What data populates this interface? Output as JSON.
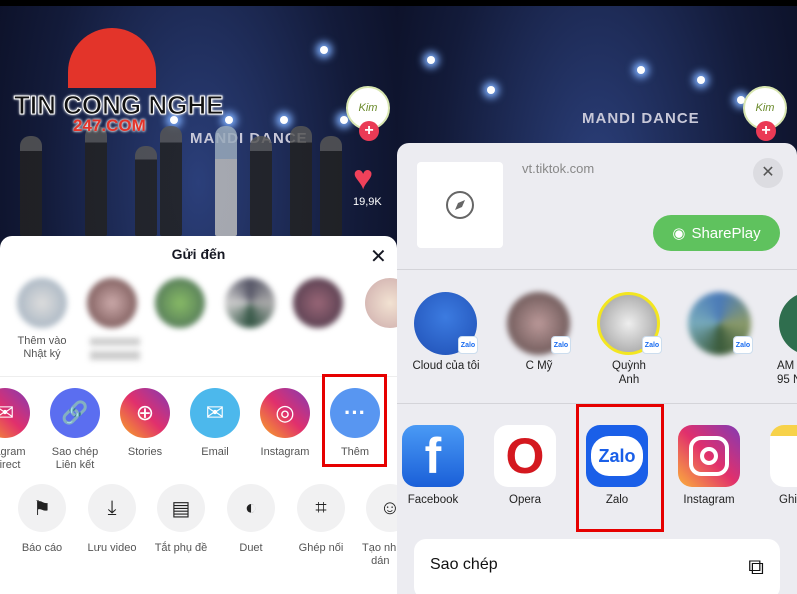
{
  "left": {
    "watermark": {
      "line1": "TIN CONG NGHE",
      "line2": "247.COM"
    },
    "video_sign": "MANDI DANCE",
    "creator_avatar_text": "Kim",
    "like_count": "19,9K",
    "sheet": {
      "title": "Gửi đến",
      "contacts": [
        {
          "label1": "Thêm vào",
          "label2": "Nhật ký"
        },
        {
          "label1": "",
          "label2": ""
        },
        {
          "label1": "",
          "label2": ""
        },
        {
          "label1": "",
          "label2": ""
        },
        {
          "label1": "",
          "label2": ""
        },
        {
          "label1": "",
          "label2": ""
        }
      ],
      "share_targets": [
        {
          "label1": "agram",
          "label2": "irect",
          "icon": "messenger-icon",
          "color": "#e1306c"
        },
        {
          "label1": "Sao chép",
          "label2": "Liên kết",
          "icon": "link-icon",
          "color": "#5b6ef0"
        },
        {
          "label1": "Stories",
          "label2": "",
          "icon": "stories-add-icon",
          "color": "#d62f7a"
        },
        {
          "label1": "Email",
          "label2": "",
          "icon": "mail-icon",
          "color": "#4cb8ec"
        },
        {
          "label1": "Instagram",
          "label2": "",
          "icon": "instagram-icon",
          "color": "#d6307a"
        },
        {
          "label1": "Thêm",
          "label2": "",
          "icon": "more-icon",
          "color": "#5896f1"
        }
      ],
      "actions": [
        {
          "label1": "Báo cáo",
          "label2": "",
          "icon": "flag-icon"
        },
        {
          "label1": "Lưu video",
          "label2": "",
          "icon": "download-icon"
        },
        {
          "label1": "Tắt phụ đề",
          "label2": "",
          "icon": "captions-off-icon"
        },
        {
          "label1": "Duet",
          "label2": "",
          "icon": "duet-icon"
        },
        {
          "label1": "Ghép nối",
          "label2": "",
          "icon": "stitch-icon"
        },
        {
          "label1": "Tạo nh",
          "label2": "dán",
          "icon": "sticker-icon"
        }
      ]
    }
  },
  "right": {
    "video_sign": "MANDI DANCE",
    "creator_avatar_text": "Kim",
    "sheet": {
      "url": "vt.tiktok.com",
      "shareplay_label": "SharePlay",
      "badge": "Zalo",
      "contacts": [
        {
          "label1": "Cloud của tôi",
          "label2": ""
        },
        {
          "label1": "C Mỹ",
          "label2": ""
        },
        {
          "label1": "Quỳnh",
          "label2": "Anh"
        },
        {
          "label1": "",
          "label2": ""
        },
        {
          "label1": "AM",
          "label2": "95 N"
        }
      ],
      "apps": [
        {
          "label": "Facebook",
          "icon_text": "f"
        },
        {
          "label": "Opera",
          "icon_text": "O"
        },
        {
          "label": "Zalo",
          "icon_text": "Zalo"
        },
        {
          "label": "Instagram",
          "icon_text": ""
        },
        {
          "label": "Ghi",
          "icon_text": ""
        }
      ],
      "copy_label": "Sao chép"
    }
  },
  "highlight_color": "#e60000"
}
